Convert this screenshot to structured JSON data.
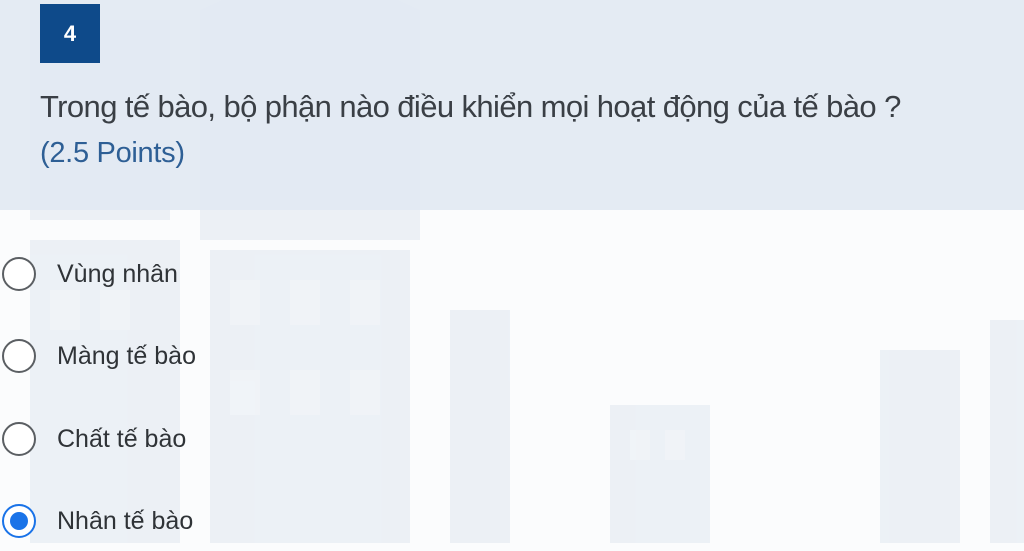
{
  "question": {
    "number": "4",
    "text": "Trong tế bào, bộ phận nào điều khiển mọi hoạt động của tế bào ?",
    "points": "(2.5 Points)"
  },
  "options": [
    {
      "label": "Vùng nhân",
      "selected": false
    },
    {
      "label": "Màng tế bào",
      "selected": false
    },
    {
      "label": "Chất tế bào",
      "selected": false
    },
    {
      "label": "Nhân tế bào",
      "selected": true
    }
  ],
  "colors": {
    "accent": "#1a73e8",
    "number_badge": "#0e4a8a",
    "header_bg": "#e2e9f2",
    "points_text": "#2e5f95"
  }
}
